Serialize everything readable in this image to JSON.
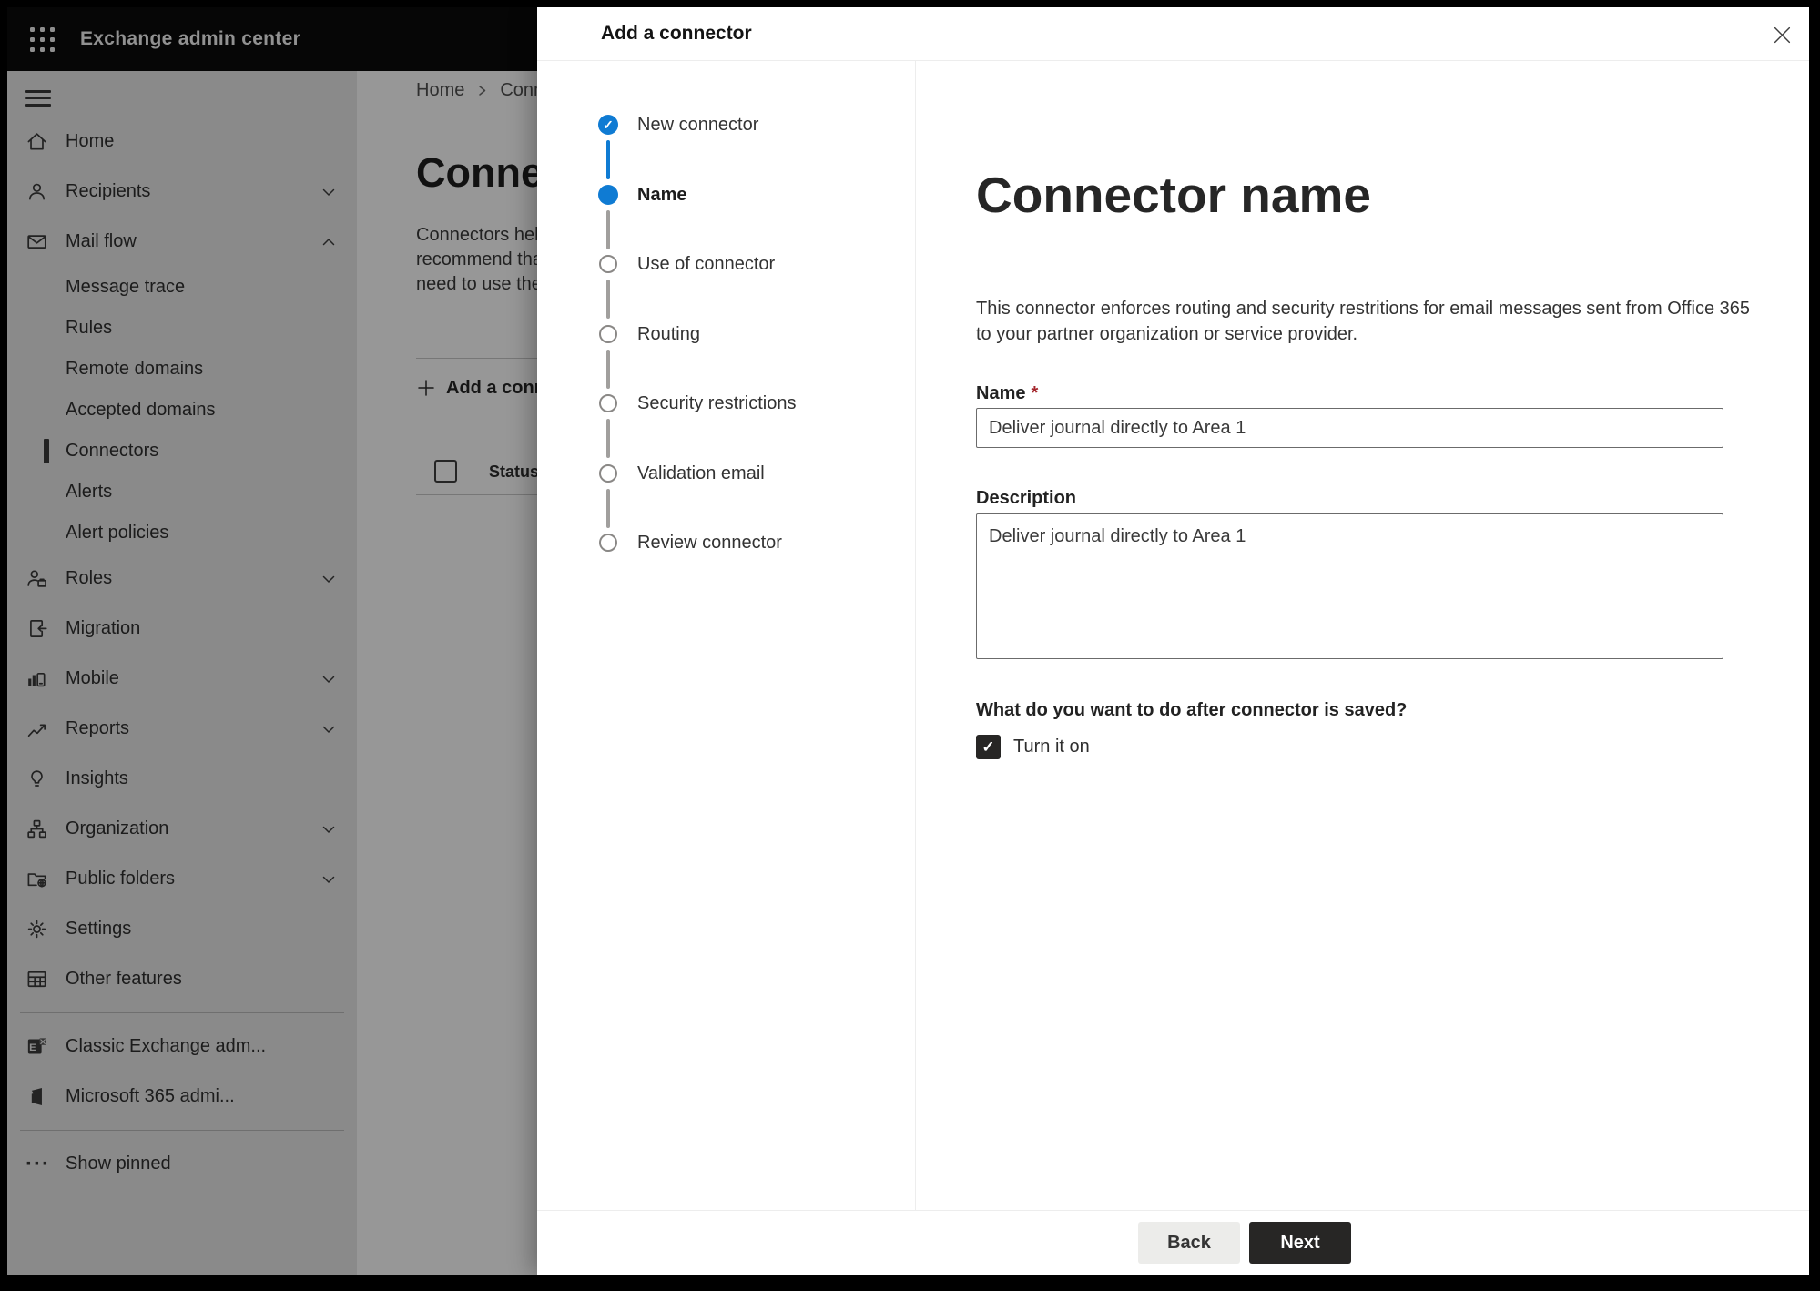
{
  "topbar": {
    "app_title": "Exchange admin center"
  },
  "sidebar": {
    "items": [
      {
        "label": "Home"
      },
      {
        "label": "Recipients"
      },
      {
        "label": "Mail flow"
      },
      {
        "label": "Message trace"
      },
      {
        "label": "Rules"
      },
      {
        "label": "Remote domains"
      },
      {
        "label": "Accepted domains"
      },
      {
        "label": "Connectors"
      },
      {
        "label": "Alerts"
      },
      {
        "label": "Alert policies"
      },
      {
        "label": "Roles"
      },
      {
        "label": "Migration"
      },
      {
        "label": "Mobile"
      },
      {
        "label": "Reports"
      },
      {
        "label": "Insights"
      },
      {
        "label": "Organization"
      },
      {
        "label": "Public folders"
      },
      {
        "label": "Settings"
      },
      {
        "label": "Other features"
      },
      {
        "label": "Classic Exchange adm..."
      },
      {
        "label": "Microsoft 365 admi..."
      },
      {
        "label": "Show pinned"
      }
    ],
    "selected_item": "Connectors"
  },
  "page": {
    "breadcrumb": {
      "root": "Home",
      "current": "Conne"
    },
    "title": "Connec",
    "intro_lines": [
      "Connectors help",
      "recommend that",
      "need to use ther"
    ],
    "add_button_label": "Add a conn",
    "status_column": "Status"
  },
  "wizard": {
    "title": "Add a connector",
    "steps": [
      {
        "label": "New connector",
        "state": "completed"
      },
      {
        "label": "Name",
        "state": "current"
      },
      {
        "label": "Use of connector",
        "state": "upcoming"
      },
      {
        "label": "Routing",
        "state": "upcoming"
      },
      {
        "label": "Security restrictions",
        "state": "upcoming"
      },
      {
        "label": "Validation email",
        "state": "upcoming"
      },
      {
        "label": "Review connector",
        "state": "upcoming"
      }
    ],
    "panel": {
      "heading": "Connector name",
      "description_lines": [
        "This connector enforces routing and security restritions for email messages sent from Office 365",
        "to your partner organization or service provider."
      ],
      "name_label": "Name",
      "required_mark": "*",
      "name_value": "Deliver journal directly to Area 1",
      "description_label": "Description",
      "description_value": "Deliver journal directly to Area 1",
      "after_save_question": "What do you want to do after connector is saved?",
      "turn_on_label": "Turn it on",
      "turn_on_checked": true
    },
    "footer": {
      "back": "Back",
      "next": "Next"
    }
  },
  "colors": {
    "accent": "#0F7BD3",
    "topbar": "#0A0A0A",
    "overlay": "rgba(0,0,0,0.40)"
  }
}
